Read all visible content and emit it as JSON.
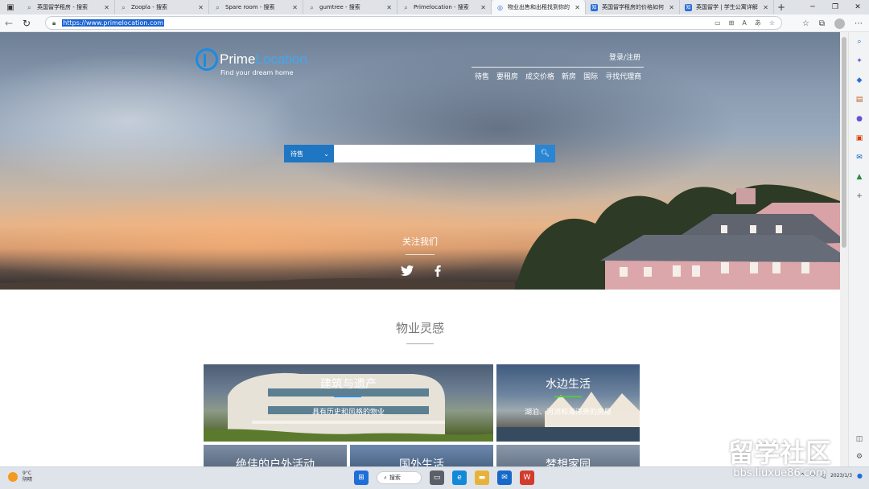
{
  "browser": {
    "tabs": [
      {
        "title": "英国留学租房 - 搜索",
        "icon": "bing-search-icon",
        "active": false
      },
      {
        "title": "Zoopla - 搜索",
        "icon": "bing-search-icon",
        "active": false
      },
      {
        "title": "Spare room - 搜索",
        "icon": "bing-search-icon",
        "active": false
      },
      {
        "title": "gumtree - 搜索",
        "icon": "bing-search-icon",
        "active": false
      },
      {
        "title": "Primelocation - 搜索",
        "icon": "bing-search-icon",
        "active": false
      },
      {
        "title": "物业出售和出租找到你的",
        "icon": "site-icon",
        "active": true
      },
      {
        "title": "英国留学租房的价格如何",
        "icon": "zhihu-icon",
        "active": false
      },
      {
        "title": "英国留学 | 学生公寓详解",
        "icon": "zhihu-icon",
        "active": false
      }
    ],
    "url": "https://www.primelocation.com"
  },
  "site": {
    "logo_prime": "Prime",
    "logo_location": "Location",
    "logo_tagline": "Find your dream home",
    "login": "登录/注册",
    "nav": [
      "待售",
      "要租房",
      "成交价格",
      "新房",
      "国际",
      "寻找代理商"
    ],
    "search_select": "待售",
    "search_placeholder": "",
    "follow_label": "关注我们",
    "section_title": "物业灵感",
    "cards": [
      {
        "title": "建筑与遗产",
        "subtitle": "具有历史和风格的物业",
        "accent": "#2d8fe0"
      },
      {
        "title": "水边生活",
        "subtitle": "湖泊、河流和海洋旁的房屋",
        "accent": "#4ccc3a"
      },
      {
        "title": "绝佳的户外活动",
        "subtitle": ""
      },
      {
        "title": "国外生活",
        "subtitle": ""
      },
      {
        "title": "梦想家园",
        "subtitle": ""
      }
    ]
  },
  "taskbar": {
    "temp": "9°C",
    "weather": "阴晴",
    "search_label": "搜索",
    "date": "2023/1/3"
  },
  "watermark": {
    "line1": "留学社区",
    "line2": "bbs.liuxue86.com"
  }
}
